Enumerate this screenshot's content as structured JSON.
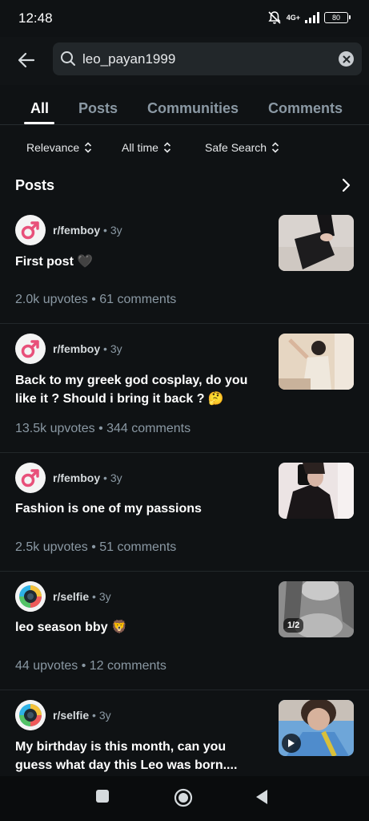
{
  "status_bar": {
    "time": "12:48",
    "network": "4G+",
    "battery": "80"
  },
  "search": {
    "query": "leo_payan1999"
  },
  "tabs": [
    {
      "label": "All",
      "active": true
    },
    {
      "label": "Posts",
      "active": false
    },
    {
      "label": "Communities",
      "active": false
    },
    {
      "label": "Comments",
      "active": false
    }
  ],
  "filters": [
    {
      "label": "Relevance"
    },
    {
      "label": "All time"
    },
    {
      "label": "Safe Search"
    }
  ],
  "section": {
    "title": "Posts"
  },
  "posts": [
    {
      "subreddit": "r/femboy",
      "age": "3y",
      "title": "First post 🖤",
      "upvotes": "2.0k upvotes",
      "comments": "61 comments",
      "avatar_icon": "male-symbol-icon"
    },
    {
      "subreddit": "r/femboy",
      "age": "3y",
      "title": "Back to my greek god cosplay, do you like it ? Should i bring it back ? 🤔",
      "upvotes": "13.5k upvotes",
      "comments": "344 comments",
      "avatar_icon": "male-symbol-icon"
    },
    {
      "subreddit": "r/femboy",
      "age": "3y",
      "title": "Fashion is one of my passions",
      "upvotes": "2.5k upvotes",
      "comments": "51 comments",
      "avatar_icon": "male-symbol-icon"
    },
    {
      "subreddit": "r/selfie",
      "age": "3y",
      "title": "leo season bby 🦁",
      "upvotes": "44 upvotes",
      "comments": "12 comments",
      "avatar_icon": "camera-lens-icon",
      "thumb_badge": "1/2"
    },
    {
      "subreddit": "r/selfie",
      "age": "3y",
      "title": "My birthday is this month, can you guess what day this Leo was born....(hint) it hasn't",
      "avatar_icon": "camera-lens-icon"
    }
  ],
  "colors": {
    "background": "#0f1214",
    "femboy_accent": "#e8507a",
    "muted_text": "#8a98a3"
  }
}
